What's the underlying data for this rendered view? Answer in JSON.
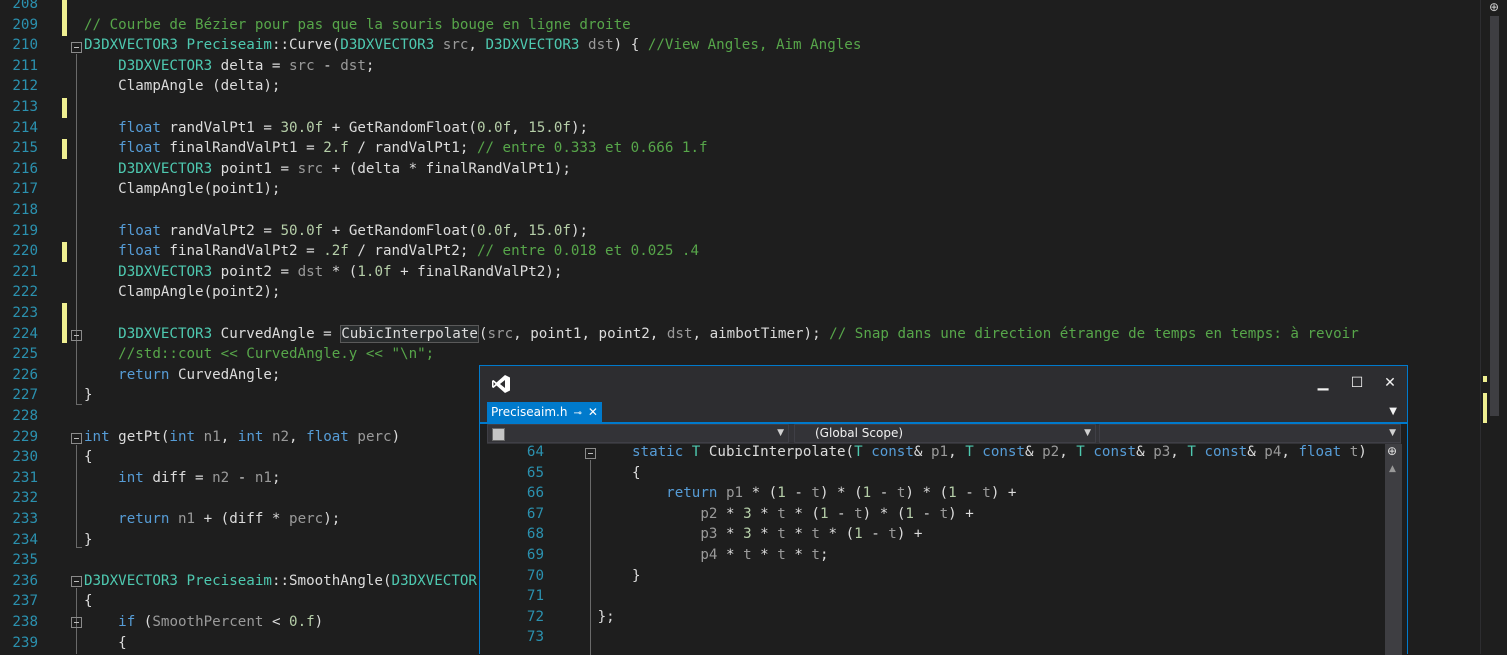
{
  "editor": {
    "lines": [
      {
        "n": "208",
        "segs": []
      },
      {
        "n": "209",
        "segs": [
          [
            "cm",
            "// Courbe de Bézier pour pas que la souris bouge en ligne droite"
          ]
        ]
      },
      {
        "n": "210",
        "segs": [
          [
            "ty",
            "D3DXVECTOR3"
          ],
          [
            "id",
            " "
          ],
          [
            "ty",
            "Preciseaim"
          ],
          [
            "id",
            "::Curve("
          ],
          [
            "ty",
            "D3DXVECTOR3"
          ],
          [
            "id",
            " "
          ],
          [
            "pm",
            "src"
          ],
          [
            "id",
            ", "
          ],
          [
            "ty",
            "D3DXVECTOR3"
          ],
          [
            "id",
            " "
          ],
          [
            "pm",
            "dst"
          ],
          [
            "id",
            ") { "
          ],
          [
            "cm",
            "//View Angles, Aim Angles"
          ]
        ]
      },
      {
        "n": "211",
        "segs": [
          [
            "id",
            "    "
          ],
          [
            "ty",
            "D3DXVECTOR3"
          ],
          [
            "id",
            " delta = "
          ],
          [
            "pm",
            "src"
          ],
          [
            "id",
            " - "
          ],
          [
            "pm",
            "dst"
          ],
          [
            "id",
            ";"
          ]
        ]
      },
      {
        "n": "212",
        "segs": [
          [
            "id",
            "    ClampAngle (delta);"
          ]
        ]
      },
      {
        "n": "213",
        "segs": []
      },
      {
        "n": "214",
        "segs": [
          [
            "id",
            "    "
          ],
          [
            "kw",
            "float"
          ],
          [
            "id",
            " randValPt1 = "
          ],
          [
            "nu",
            "30.0f"
          ],
          [
            "id",
            " + GetRandomFloat("
          ],
          [
            "nu",
            "0.0f"
          ],
          [
            "id",
            ", "
          ],
          [
            "nu",
            "15.0f"
          ],
          [
            "id",
            ");"
          ]
        ]
      },
      {
        "n": "215",
        "segs": [
          [
            "id",
            "    "
          ],
          [
            "kw",
            "float"
          ],
          [
            "id",
            " finalRandValPt1 = "
          ],
          [
            "nu",
            "2.f"
          ],
          [
            "id",
            " / randValPt1; "
          ],
          [
            "cm",
            "// entre 0.333 et 0.666 1.f"
          ]
        ]
      },
      {
        "n": "216",
        "segs": [
          [
            "id",
            "    "
          ],
          [
            "ty",
            "D3DXVECTOR3"
          ],
          [
            "id",
            " point1 = "
          ],
          [
            "pm",
            "src"
          ],
          [
            "id",
            " + (delta * finalRandValPt1);"
          ]
        ]
      },
      {
        "n": "217",
        "segs": [
          [
            "id",
            "    ClampAngle(point1);"
          ]
        ]
      },
      {
        "n": "218",
        "segs": []
      },
      {
        "n": "219",
        "segs": [
          [
            "id",
            "    "
          ],
          [
            "kw",
            "float"
          ],
          [
            "id",
            " randValPt2 = "
          ],
          [
            "nu",
            "50.0f"
          ],
          [
            "id",
            " + GetRandomFloat("
          ],
          [
            "nu",
            "0.0f"
          ],
          [
            "id",
            ", "
          ],
          [
            "nu",
            "15.0f"
          ],
          [
            "id",
            ");"
          ]
        ]
      },
      {
        "n": "220",
        "segs": [
          [
            "id",
            "    "
          ],
          [
            "kw",
            "float"
          ],
          [
            "id",
            " finalRandValPt2 = "
          ],
          [
            "nu",
            ".2f"
          ],
          [
            "id",
            " / randValPt2; "
          ],
          [
            "cm",
            "// entre 0.018 et 0.025 .4"
          ]
        ]
      },
      {
        "n": "221",
        "segs": [
          [
            "id",
            "    "
          ],
          [
            "ty",
            "D3DXVECTOR3"
          ],
          [
            "id",
            " point2 = "
          ],
          [
            "pm",
            "dst"
          ],
          [
            "id",
            " * ("
          ],
          [
            "nu",
            "1.0f"
          ],
          [
            "id",
            " + finalRandValPt2);"
          ]
        ]
      },
      {
        "n": "222",
        "segs": [
          [
            "id",
            "    ClampAngle(point2);"
          ]
        ]
      },
      {
        "n": "223",
        "segs": []
      },
      {
        "n": "224",
        "segs": [
          [
            "id",
            "    "
          ],
          [
            "ty",
            "D3DXVECTOR3"
          ],
          [
            "id",
            " CurvedAngle = "
          ],
          [
            "hl",
            "CubicInterpolate"
          ],
          [
            "id",
            "("
          ],
          [
            "pm",
            "src"
          ],
          [
            "id",
            ", point1, point2, "
          ],
          [
            "pm",
            "dst"
          ],
          [
            "id",
            ", "
          ],
          [
            "lv",
            "aimbotTimer"
          ],
          [
            "id",
            "); "
          ],
          [
            "cm",
            "// Snap dans une direction étrange de temps en temps: à revoir"
          ]
        ]
      },
      {
        "n": "225",
        "segs": [
          [
            "id",
            "    "
          ],
          [
            "cm",
            "//std::cout << CurvedAngle.y << \"\\n\";"
          ]
        ]
      },
      {
        "n": "226",
        "segs": [
          [
            "id",
            "    "
          ],
          [
            "kw",
            "return"
          ],
          [
            "id",
            " CurvedAngle;"
          ]
        ]
      },
      {
        "n": "227",
        "segs": [
          [
            "id",
            "}"
          ]
        ]
      },
      {
        "n": "228",
        "segs": []
      },
      {
        "n": "229",
        "segs": [
          [
            "kw",
            "int"
          ],
          [
            "id",
            " getPt("
          ],
          [
            "kw",
            "int"
          ],
          [
            "id",
            " "
          ],
          [
            "pm",
            "n1"
          ],
          [
            "id",
            ", "
          ],
          [
            "kw",
            "int"
          ],
          [
            "id",
            " "
          ],
          [
            "pm",
            "n2"
          ],
          [
            "id",
            ", "
          ],
          [
            "kw",
            "float"
          ],
          [
            "id",
            " "
          ],
          [
            "pm",
            "perc"
          ],
          [
            "id",
            ")"
          ]
        ]
      },
      {
        "n": "230",
        "segs": [
          [
            "id",
            "{"
          ]
        ]
      },
      {
        "n": "231",
        "segs": [
          [
            "id",
            "    "
          ],
          [
            "kw",
            "int"
          ],
          [
            "id",
            " diff = "
          ],
          [
            "pm",
            "n2"
          ],
          [
            "id",
            " - "
          ],
          [
            "pm",
            "n1"
          ],
          [
            "id",
            ";"
          ]
        ]
      },
      {
        "n": "232",
        "segs": []
      },
      {
        "n": "233",
        "segs": [
          [
            "id",
            "    "
          ],
          [
            "kw",
            "return"
          ],
          [
            "id",
            " "
          ],
          [
            "pm",
            "n1"
          ],
          [
            "id",
            " + (diff * "
          ],
          [
            "pm",
            "perc"
          ],
          [
            "id",
            ");"
          ]
        ]
      },
      {
        "n": "234",
        "segs": [
          [
            "id",
            "}"
          ]
        ]
      },
      {
        "n": "235",
        "segs": []
      },
      {
        "n": "236",
        "segs": [
          [
            "ty",
            "D3DXVECTOR3"
          ],
          [
            "id",
            " "
          ],
          [
            "ty",
            "Preciseaim"
          ],
          [
            "id",
            "::SmoothAngle("
          ],
          [
            "ty",
            "D3DXVECTOR"
          ]
        ]
      },
      {
        "n": "237",
        "segs": [
          [
            "id",
            "{"
          ]
        ]
      },
      {
        "n": "238",
        "segs": [
          [
            "id",
            "    "
          ],
          [
            "kw",
            "if"
          ],
          [
            "id",
            " ("
          ],
          [
            "pm",
            "SmoothPercent"
          ],
          [
            "id",
            " < "
          ],
          [
            "nu",
            "0.f"
          ],
          [
            "id",
            ")"
          ]
        ]
      },
      {
        "n": "239",
        "segs": [
          [
            "id",
            "    {"
          ]
        ]
      }
    ]
  },
  "peek": {
    "tab_label": "Preciseaim.h",
    "tab_pin": "⊸",
    "tab_close": "✕",
    "scope_label": "(Global Scope)",
    "minimize": "▁",
    "maximize": "☐",
    "close": "✕",
    "lines": [
      {
        "n": "64",
        "segs": [
          [
            "kw",
            "static"
          ],
          [
            "id",
            " "
          ],
          [
            "ty",
            "T"
          ],
          [
            "id",
            " CubicInterpolate("
          ],
          [
            "ty",
            "T"
          ],
          [
            "id",
            " "
          ],
          [
            "kw",
            "const"
          ],
          [
            "id",
            "& "
          ],
          [
            "pm",
            "p1"
          ],
          [
            "id",
            ", "
          ],
          [
            "ty",
            "T"
          ],
          [
            "id",
            " "
          ],
          [
            "kw",
            "const"
          ],
          [
            "id",
            "& "
          ],
          [
            "pm",
            "p2"
          ],
          [
            "id",
            ", "
          ],
          [
            "ty",
            "T"
          ],
          [
            "id",
            " "
          ],
          [
            "kw",
            "const"
          ],
          [
            "id",
            "& "
          ],
          [
            "pm",
            "p3"
          ],
          [
            "id",
            ", "
          ],
          [
            "ty",
            "T"
          ],
          [
            "id",
            " "
          ],
          [
            "kw",
            "const"
          ],
          [
            "id",
            "& "
          ],
          [
            "pm",
            "p4"
          ],
          [
            "id",
            ", "
          ],
          [
            "kw",
            "float"
          ],
          [
            "id",
            " "
          ],
          [
            "pm",
            "t"
          ],
          [
            "id",
            ")"
          ]
        ]
      },
      {
        "n": "65",
        "segs": [
          [
            "id",
            "{"
          ]
        ]
      },
      {
        "n": "66",
        "segs": [
          [
            "id",
            "    "
          ],
          [
            "kw",
            "return"
          ],
          [
            "id",
            " "
          ],
          [
            "pm",
            "p1"
          ],
          [
            "id",
            " * ("
          ],
          [
            "nu",
            "1"
          ],
          [
            "id",
            " - "
          ],
          [
            "pm",
            "t"
          ],
          [
            "id",
            ") * ("
          ],
          [
            "nu",
            "1"
          ],
          [
            "id",
            " - "
          ],
          [
            "pm",
            "t"
          ],
          [
            "id",
            ") * ("
          ],
          [
            "nu",
            "1"
          ],
          [
            "id",
            " - "
          ],
          [
            "pm",
            "t"
          ],
          [
            "id",
            ") +"
          ]
        ]
      },
      {
        "n": "67",
        "segs": [
          [
            "id",
            "        "
          ],
          [
            "pm",
            "p2"
          ],
          [
            "id",
            " * "
          ],
          [
            "nu",
            "3"
          ],
          [
            "id",
            " * "
          ],
          [
            "pm",
            "t"
          ],
          [
            "id",
            " * ("
          ],
          [
            "nu",
            "1"
          ],
          [
            "id",
            " - "
          ],
          [
            "pm",
            "t"
          ],
          [
            "id",
            ") * ("
          ],
          [
            "nu",
            "1"
          ],
          [
            "id",
            " - "
          ],
          [
            "pm",
            "t"
          ],
          [
            "id",
            ") +"
          ]
        ]
      },
      {
        "n": "68",
        "segs": [
          [
            "id",
            "        "
          ],
          [
            "pm",
            "p3"
          ],
          [
            "id",
            " * "
          ],
          [
            "nu",
            "3"
          ],
          [
            "id",
            " * "
          ],
          [
            "pm",
            "t"
          ],
          [
            "id",
            " * "
          ],
          [
            "pm",
            "t"
          ],
          [
            "id",
            " * ("
          ],
          [
            "nu",
            "1"
          ],
          [
            "id",
            " - "
          ],
          [
            "pm",
            "t"
          ],
          [
            "id",
            ") +"
          ]
        ]
      },
      {
        "n": "69",
        "segs": [
          [
            "id",
            "        "
          ],
          [
            "pm",
            "p4"
          ],
          [
            "id",
            " * "
          ],
          [
            "pm",
            "t"
          ],
          [
            "id",
            " * "
          ],
          [
            "pm",
            "t"
          ],
          [
            "id",
            " * "
          ],
          [
            "pm",
            "t"
          ],
          [
            "id",
            ";"
          ]
        ]
      },
      {
        "n": "70",
        "segs": [
          [
            "id",
            "}"
          ]
        ]
      },
      {
        "n": "71",
        "segs": []
      },
      {
        "n": "72",
        "segs": [
          [
            "id",
            "};"
          ]
        ],
        "indent": -4
      },
      {
        "n": "73",
        "segs": []
      }
    ]
  },
  "icons": {
    "vs_logo": "visual-studio-icon",
    "split": "⊕"
  }
}
